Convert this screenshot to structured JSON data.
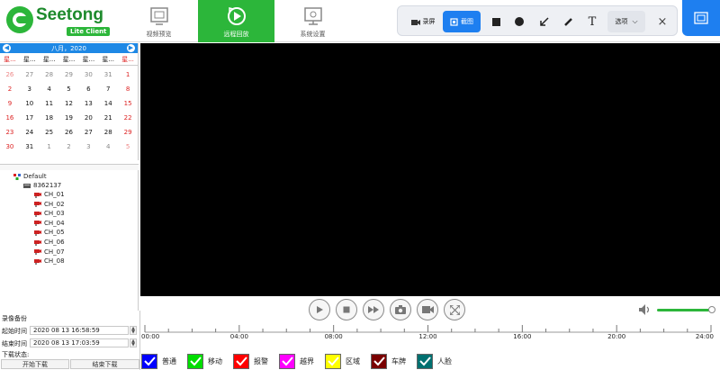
{
  "app": {
    "logo_text": "Seetong",
    "logo_badge": "Lite Client"
  },
  "nav": {
    "tabs": [
      {
        "label": "视频预览"
      },
      {
        "label": "远程回放"
      },
      {
        "label": "系统设置"
      }
    ],
    "active": 1
  },
  "snip_toolbar": {
    "record_label": "录屏",
    "screenshot_label": "截图",
    "text_glyph": "T",
    "options_label": "选项",
    "close_glyph": "×"
  },
  "calendar": {
    "month_title": "八月，2020",
    "weekdays": [
      "星期日",
      "星期一",
      "星期二",
      "星期三",
      "星期四",
      "星期五",
      "星期六"
    ],
    "weekday_short": [
      "星...",
      "星...",
      "星...",
      "星...",
      "星...",
      "星...",
      "星..."
    ],
    "weeks": [
      [
        "26",
        "27",
        "28",
        "29",
        "30",
        "31",
        "1"
      ],
      [
        "2",
        "3",
        "4",
        "5",
        "6",
        "7",
        "8"
      ],
      [
        "9",
        "10",
        "11",
        "12",
        "13",
        "14",
        "15"
      ],
      [
        "16",
        "17",
        "18",
        "19",
        "20",
        "21",
        "22"
      ],
      [
        "23",
        "24",
        "25",
        "26",
        "27",
        "28",
        "29"
      ],
      [
        "30",
        "31",
        "1",
        "2",
        "3",
        "4",
        "5"
      ]
    ]
  },
  "tree": {
    "root": "Default",
    "device": "8362137",
    "channels": [
      "CH_01",
      "CH_02",
      "CH_03",
      "CH_04",
      "CH_05",
      "CH_06",
      "CH_07",
      "CH_08"
    ]
  },
  "backup": {
    "title": "录像备份",
    "start_label": "起始时间",
    "start_value": "2020 08 13 16:58:59",
    "end_label": "结束时间",
    "end_value": "2020 08 13 17:03:59",
    "status_label": "下载状态:",
    "start_download": "开始下载",
    "end_download": "结束下载"
  },
  "timeline": {
    "ticks": [
      "00:00",
      "04:00",
      "08:00",
      "12:00",
      "16:00",
      "20:00",
      "24:00"
    ]
  },
  "volume": {
    "level": 0.95
  },
  "legend": [
    {
      "label": "普通",
      "color": "#0000ff"
    },
    {
      "label": "移动",
      "color": "#00dd00"
    },
    {
      "label": "报警",
      "color": "#ff0000"
    },
    {
      "label": "越界",
      "color": "#ff00ff"
    },
    {
      "label": "区域",
      "color": "#ffff00"
    },
    {
      "label": "车牌",
      "color": "#7a0000"
    },
    {
      "label": "人脸",
      "color": "#007070"
    }
  ]
}
